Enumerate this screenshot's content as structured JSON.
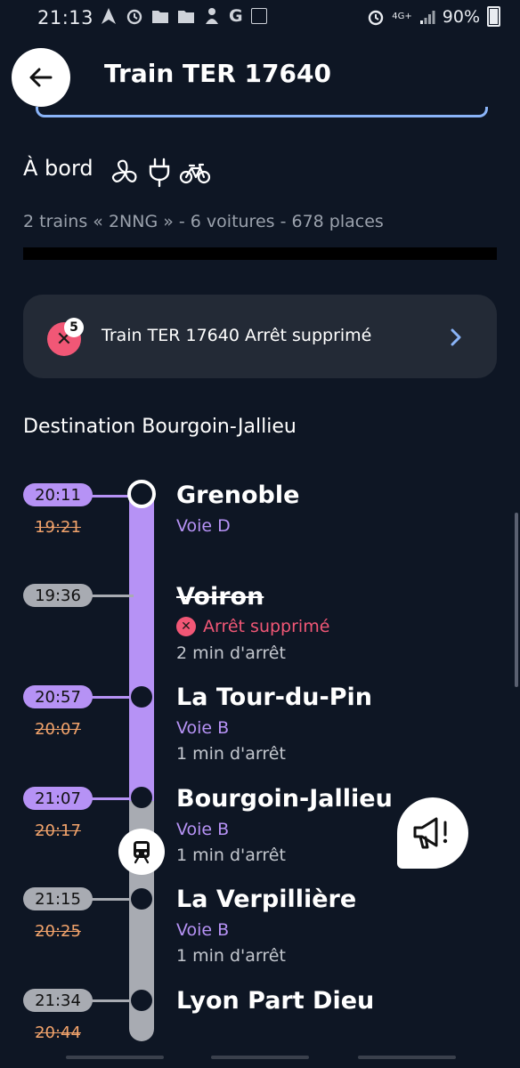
{
  "status_bar": {
    "time": "21:13",
    "network": "4G+",
    "battery": "90%"
  },
  "header": {
    "title": "Train TER 17640"
  },
  "onboard": {
    "label": "À bord",
    "amenities": [
      "fan-icon",
      "power-plug-icon",
      "bicycle-icon"
    ],
    "train_info": "2 trains « 2NNG » - 6 voitures - 678 places"
  },
  "alert": {
    "text": "Train TER 17640 Arrêt supprimé",
    "badge_count": "5"
  },
  "destination": "Destination Bourgoin-Jallieu",
  "stops": [
    {
      "time": "20:11",
      "old_time": "19:21",
      "station": "Grenoble",
      "voie": "Voie D",
      "duration": "",
      "cancelled": false
    },
    {
      "time": "19:36",
      "old_time": "",
      "station": "Voiron",
      "voie": "",
      "cancel_text": "Arrêt supprimé",
      "duration": "2 min d'arrêt",
      "cancelled": true
    },
    {
      "time": "20:57",
      "old_time": "20:07",
      "station": "La Tour-du-Pin",
      "voie": "Voie B",
      "duration": "1 min d'arrêt",
      "cancelled": false
    },
    {
      "time": "21:07",
      "old_time": "20:17",
      "station": "Bourgoin-Jallieu",
      "voie": "Voie B",
      "duration": "1 min d'arrêt",
      "cancelled": false
    },
    {
      "time": "21:15",
      "old_time": "20:25",
      "station": "La Verpillière",
      "voie": "Voie B",
      "duration": "1 min d'arrêt",
      "cancelled": false
    },
    {
      "time": "21:34",
      "old_time": "20:44",
      "station": "Lyon Part Dieu",
      "voie": "",
      "duration": "",
      "cancelled": false
    }
  ],
  "colors": {
    "background": "#0e1624",
    "accent_purple": "#b692f5",
    "cancel_red": "#f15776",
    "old_time_orange": "#f2a36b",
    "card": "#232a36"
  }
}
